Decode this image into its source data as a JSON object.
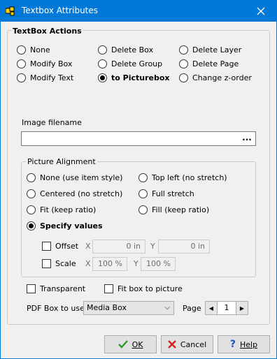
{
  "window": {
    "title": "Textbox Attributes",
    "accent": "#0078d7"
  },
  "actions": {
    "group_label": "TextBox Actions",
    "options": [
      "None",
      "Modify Box",
      "Modify Text",
      "Delete Box",
      "Delete Group",
      "to Picturebox",
      "Delete Layer",
      "Delete Page",
      "Change z-order"
    ],
    "selected": "to Picturebox"
  },
  "image": {
    "label": "Image filename",
    "value": "",
    "browse": "..."
  },
  "alignment": {
    "group_label": "Picture Alignment",
    "options": [
      "None (use item style)",
      "Centered (no stretch)",
      "Fit (keep ratio)",
      "Top left (no stretch)",
      "Full stretch",
      "Fill (keep ratio)",
      "Specify values"
    ],
    "selected": "Specify values",
    "offset": {
      "label": "Offset",
      "x_axis": "X",
      "x": "0 in",
      "y_axis": "Y",
      "y": "0 in"
    },
    "scale": {
      "label": "Scale",
      "x_axis": "X",
      "x": "100 %",
      "y_axis": "Y",
      "y": "100 %"
    }
  },
  "options": {
    "transparent": "Transparent",
    "fit_box": "Fit box to picture",
    "pdf_box_label": "PDF Box to use",
    "pdf_box_value": "Media Box",
    "page_label": "Page",
    "page_value": "1"
  },
  "buttons": {
    "ok": "OK",
    "cancel": "Cancel",
    "help": "Help"
  },
  "icons": {
    "app": "puzzle-icon",
    "close": "close-icon",
    "ok": "checkmark-icon",
    "cancel": "x-mark-icon",
    "help": "question-mark-icon"
  },
  "colors": {
    "ok_check": "#2a9a2a",
    "cancel_x": "#d42020",
    "help_mark": "#1a55c8"
  }
}
